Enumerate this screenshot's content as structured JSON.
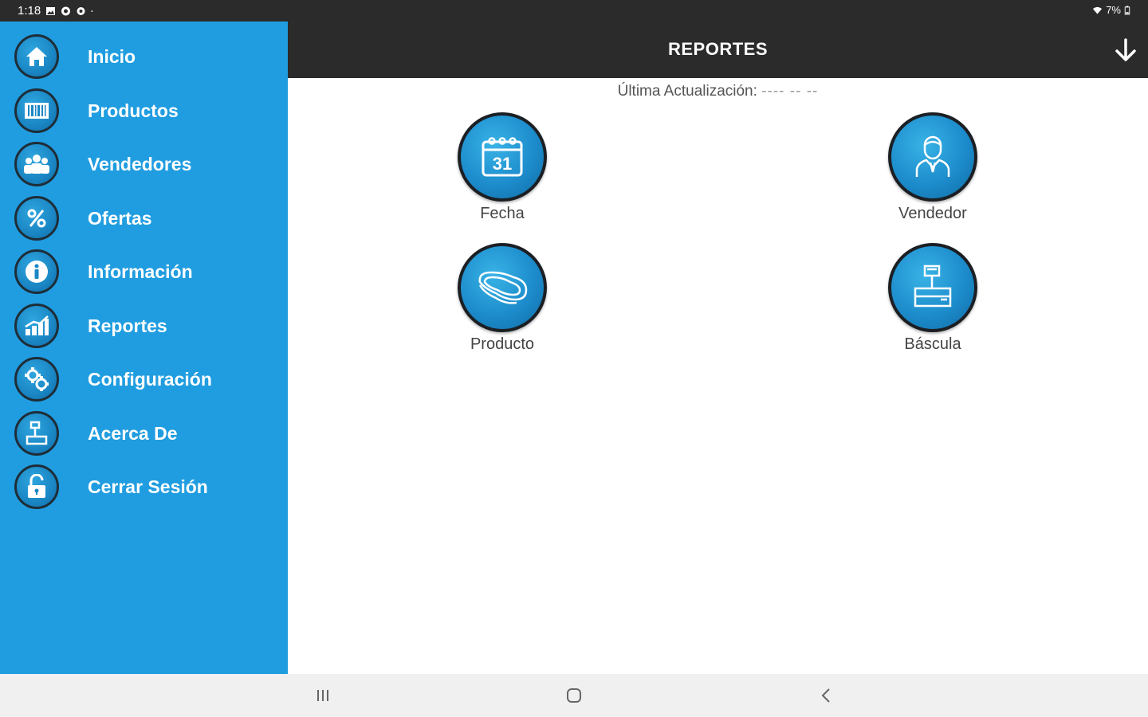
{
  "status_bar": {
    "time": "1:18",
    "battery": "7%",
    "left_icons": [
      "gallery-icon",
      "circle-icon",
      "settings-icon",
      "dot-icon"
    ],
    "right_icons": [
      "wifi-icon",
      "battery-icon"
    ]
  },
  "header": {
    "title": "REPORTES",
    "action_icon": "download-arrow-icon"
  },
  "sidebar": {
    "items": [
      {
        "label": "Inicio",
        "icon": "home-icon"
      },
      {
        "label": "Productos",
        "icon": "barcode-icon"
      },
      {
        "label": "Vendedores",
        "icon": "users-icon"
      },
      {
        "label": "Ofertas",
        "icon": "percent-icon"
      },
      {
        "label": "Información",
        "icon": "info-icon"
      },
      {
        "label": "Reportes",
        "icon": "chart-icon"
      },
      {
        "label": "Configuración",
        "icon": "gears-icon"
      },
      {
        "label": "Acerca De",
        "icon": "scale-icon"
      },
      {
        "label": "Cerrar Sesión",
        "icon": "unlock-icon"
      }
    ]
  },
  "main": {
    "last_update_label": "Última Actualización:",
    "last_update_value": "---- -- --",
    "reports": [
      {
        "label": "Fecha",
        "icon": "calendar-icon",
        "calendar_day": "31"
      },
      {
        "label": "Vendedor",
        "icon": "salesperson-icon"
      },
      {
        "label": "Producto",
        "icon": "meat-icon"
      },
      {
        "label": "Báscula",
        "icon": "scale-icon"
      }
    ]
  },
  "nav_bar": {
    "buttons": [
      "recents-icon",
      "home-icon",
      "back-icon"
    ]
  },
  "colors": {
    "sidebar_bg": "#209de0",
    "appbar_bg": "#2b2b2b",
    "icon_blue": "#1d8ccc",
    "navbar_bg": "#f0f0f0"
  }
}
